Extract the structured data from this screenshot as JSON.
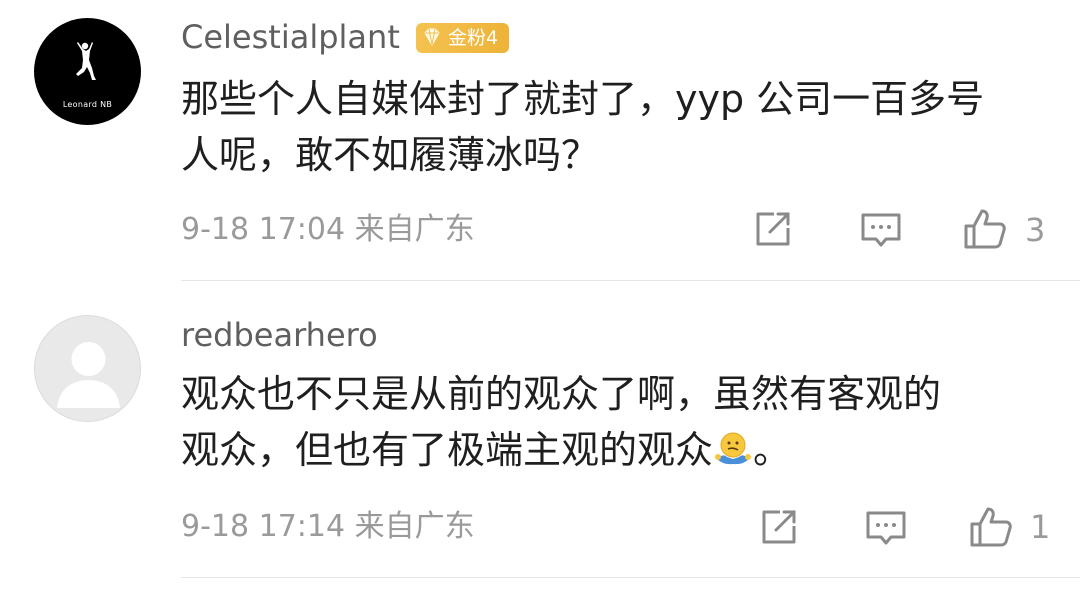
{
  "comments": [
    {
      "username": "Celestialplant",
      "badge": "金粉4",
      "avatar_caption": "Leonard  NB",
      "text_line1": "那些个人自媒体封了就封了，yyp 公司一百多号",
      "text_line2": "人呢，敢不如履薄冰吗？",
      "time": "9-18 17:04",
      "location": "来自广东",
      "likes": "3"
    },
    {
      "username": "redbearhero",
      "text_line1": "观众也不只是从前的观众了啊，虽然有客观的",
      "text_line2_pre": "观众，但也有了极端主观的观众",
      "emoji": "shrug-emoji",
      "text_line2_post": "。",
      "time": "9-18 17:14",
      "location": "来自广东",
      "likes": "1"
    }
  ],
  "icons": {
    "share": "share-icon",
    "comment": "comment-icon",
    "like": "thumbs-up-icon"
  },
  "colors": {
    "badge": "#f0b73c",
    "meta": "#9a9a9a",
    "username": "#5f5f5f"
  }
}
